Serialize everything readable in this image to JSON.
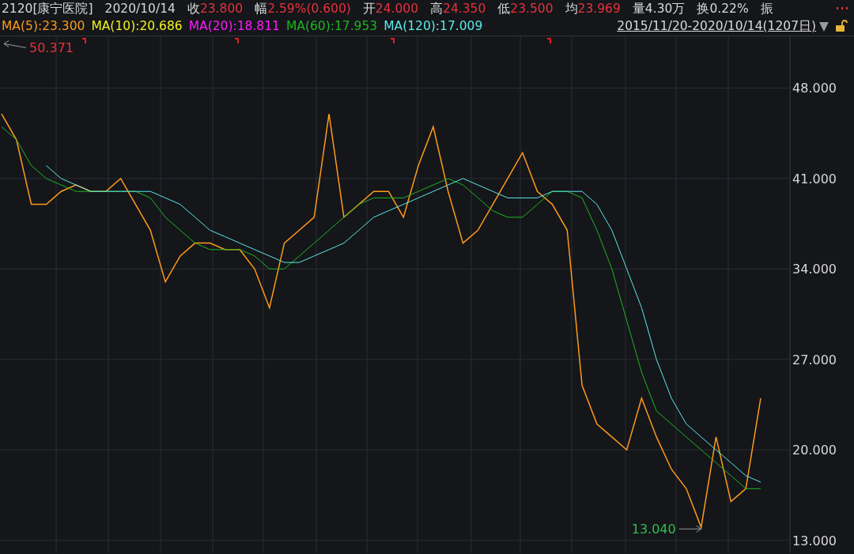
{
  "quote": {
    "stock": "2120[康宁医院]",
    "date": "2020/10/14",
    "fields": [
      {
        "label": "收",
        "value": "23.800",
        "color": "#e8323a"
      },
      {
        "label": "幅",
        "value": "2.59%(0.600)",
        "color": "#e8323a"
      },
      {
        "label": "开",
        "value": "24.000",
        "color": "#e8323a"
      },
      {
        "label": "高",
        "value": "24.350",
        "color": "#e8323a"
      },
      {
        "label": "低",
        "value": "23.500",
        "color": "#e8323a"
      },
      {
        "label": "均",
        "value": "23.969",
        "color": "#e8323a"
      },
      {
        "label": "量",
        "value": "4.30万",
        "color": "#d8d8d8"
      },
      {
        "label": "换",
        "value": "0.22%",
        "color": "#d8d8d8"
      },
      {
        "label": "振"
      }
    ]
  },
  "ma_legend": [
    {
      "name": "MA(5)",
      "value": ":23.300",
      "color": "#ff9a1a"
    },
    {
      "name": "MA(10)",
      "value": ":20.686",
      "color": "#f2f21a"
    },
    {
      "name": "MA(20)",
      "value": ":18.811",
      "color": "#ff1aff"
    },
    {
      "name": "MA(60)",
      "value": ":17.953",
      "color": "#1fb51f"
    },
    {
      "name": "MA(120)",
      "value": ":17.009",
      "color": "#5ee8e8"
    }
  ],
  "extremes": [
    {
      "text": "50.371",
      "color": "#e8323a",
      "points_left": true
    },
    {
      "text": "13.040",
      "color": "#2fbf4f",
      "points_left": false
    }
  ],
  "range": {
    "text": "2015/11/20-2020/10/14(1207日)",
    "dropdown": "▼"
  },
  "chart_data": {
    "type": "line",
    "grid": true,
    "ylim": [
      12,
      52
    ],
    "yticks": [
      {
        "value": 48,
        "label": "48.000"
      },
      {
        "value": 41,
        "label": "41.000"
      },
      {
        "value": 34,
        "label": "34.000"
      },
      {
        "value": 27,
        "label": "27.000"
      },
      {
        "value": 20,
        "label": "20.000"
      },
      {
        "value": 13,
        "label": "13.000"
      }
    ],
    "categories": [
      null,
      null,
      null,
      null,
      null,
      null,
      null,
      null,
      null,
      null,
      null,
      null,
      null,
      null,
      null,
      null,
      null,
      null,
      null,
      null,
      null,
      null,
      null,
      null,
      null,
      null,
      null,
      null,
      null,
      null,
      null,
      null,
      null,
      null,
      null,
      null,
      null,
      null,
      null,
      null,
      null,
      null,
      null,
      null,
      null,
      null,
      null,
      null,
      null,
      null,
      null,
      null
    ],
    "series": [
      {
        "color": "#ff9a1a",
        "values": [
          46,
          44,
          39,
          39,
          40,
          40.5,
          40,
          40,
          41,
          39,
          37,
          33,
          35,
          36,
          36,
          35.5,
          35.5,
          34,
          31,
          36,
          37,
          38,
          46,
          38,
          39,
          40,
          40,
          38,
          42,
          45,
          40,
          36,
          37,
          39,
          41,
          43,
          40,
          39,
          37,
          25,
          22,
          21,
          20,
          24,
          21,
          18.5,
          17,
          14,
          21,
          16,
          17,
          24
        ]
      },
      {
        "color": "#1fb51f",
        "values": [
          45,
          44,
          42,
          41,
          40.5,
          40,
          40,
          40,
          40,
          40,
          39.5,
          38,
          37,
          36,
          35.5,
          35.5,
          35.5,
          35,
          34,
          34,
          35,
          36,
          37,
          38,
          39,
          39.5,
          39.5,
          39.5,
          40,
          40.5,
          41,
          40.5,
          39.5,
          38.5,
          38,
          38,
          39,
          40,
          40,
          39.5,
          37,
          34,
          30,
          26,
          23,
          22,
          21,
          20,
          19,
          18,
          17,
          17
        ]
      },
      {
        "color": "#5ee8e8",
        "values": [
          null,
          null,
          null,
          42,
          41,
          40.5,
          40,
          40,
          40,
          40,
          40,
          39.5,
          39,
          38,
          37,
          36.5,
          36,
          35.5,
          35,
          34.5,
          34.5,
          35,
          35.5,
          36,
          37,
          38,
          38.5,
          39,
          39.5,
          40,
          40.5,
          41,
          40.5,
          40,
          39.5,
          39.5,
          39.5,
          40,
          40,
          40,
          39,
          37,
          34,
          31,
          27,
          24,
          22,
          21,
          20,
          19,
          18,
          17.5
        ]
      }
    ]
  }
}
